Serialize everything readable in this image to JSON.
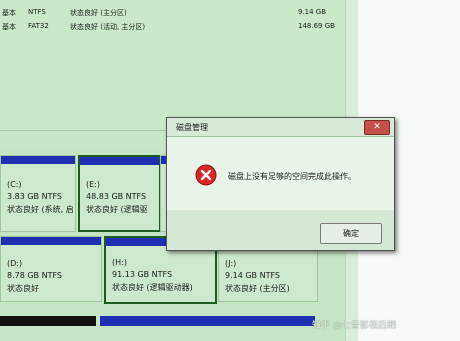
{
  "volume_table": {
    "rows": [
      {
        "type": "基本",
        "fs": "NTFS",
        "status": "状态良好 (主分区)",
        "capacity": "9.14 GB"
      },
      {
        "type": "基本",
        "fs": "FAT32",
        "status": "状态良好 (活动, 主分区)",
        "capacity": "148.69 GB"
      }
    ]
  },
  "volumes": [
    {
      "name": "(C:)",
      "size": "3.83 GB NTFS",
      "status": "状态良好 (系统, 启"
    },
    {
      "name": "(E:)",
      "size": "48.83 GB NTFS",
      "status": "状态良好 (逻辑驱"
    },
    {
      "name": "(D:)",
      "size": "8.78 GB NTFS",
      "status": "状态良好"
    },
    {
      "name": "(H:)",
      "size": "91.13 GB NTFS",
      "status": "状态良好 (逻辑驱动器)"
    },
    {
      "name": "(J:)",
      "size": "9.14 GB NTFS",
      "status": "状态良好 (主分区)"
    }
  ],
  "dialog": {
    "title": "磁盘管理",
    "message": "磁盘上没有足够的空间完成此操作。",
    "ok_label": "确定",
    "close_symbol": "✕"
  },
  "watermark": "知乎 @七音影视后期",
  "colors": {
    "bar_blue": "#1e2fb3",
    "error_red": "#d9262b"
  }
}
